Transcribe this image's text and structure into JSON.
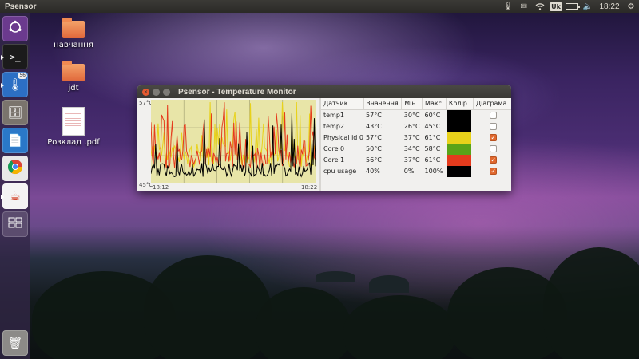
{
  "top_panel": {
    "app_title": "Psensor",
    "tray": {
      "psensor_icon": "thermometer-icon",
      "mail_icon": "envelope-icon",
      "network_icon": "wifi-icon",
      "keyboard_layout": "Uk",
      "battery_level": 0.85,
      "volume_icon": "speaker-icon",
      "time": "18:22",
      "settings_icon": "gear-icon"
    }
  },
  "launcher": {
    "items": [
      {
        "name": "dash-home",
        "icon": "ubuntu-logo-icon",
        "bg": "#6b3a8e"
      },
      {
        "name": "terminal",
        "icon": "terminal-icon",
        "bg": "#1b1b1b"
      },
      {
        "name": "psensor",
        "icon": "thermometer-icon",
        "bg": "#2c6fc4",
        "count": "56"
      },
      {
        "name": "files",
        "icon": "file-cabinet-icon",
        "bg": "#7a746d"
      },
      {
        "name": "libreoffice",
        "icon": "document-icon",
        "bg": "#2a78c8"
      },
      {
        "name": "chrome",
        "icon": "chrome-icon",
        "bg": "#e8e8e8"
      },
      {
        "name": "java",
        "icon": "java-cup-icon",
        "bg": "#f4f4f4"
      },
      {
        "name": "workspace-switcher",
        "icon": "workspaces-icon",
        "bg": "#5b4c6e"
      },
      {
        "name": "trash",
        "icon": "trash-icon",
        "bg": "#8c8a88"
      }
    ]
  },
  "desktop": {
    "icons": [
      {
        "label": "навчання",
        "type": "folder"
      },
      {
        "label": "jdt",
        "type": "folder"
      },
      {
        "label": "Розклад .pdf",
        "type": "pdf"
      }
    ]
  },
  "window": {
    "title": "Psensor - Temperature Monitor",
    "graph": {
      "y_top": "57°C",
      "y_bottom": "45°C",
      "x_start": "18:12",
      "x_end": "18:22",
      "background": "#e8e5a8"
    },
    "table": {
      "headers": [
        "Датчик",
        "Значення",
        "Мін.",
        "Макс.",
        "Колір",
        "Діаграма"
      ],
      "rows": [
        {
          "sensor": "temp1",
          "value": "57°C",
          "min": "30°C",
          "max": "60°C",
          "color": "#000000",
          "graph": false
        },
        {
          "sensor": "temp2",
          "value": "43°C",
          "min": "26°C",
          "max": "45°C",
          "color": "#000000",
          "graph": false
        },
        {
          "sensor": "Physical id 0",
          "value": "57°C",
          "min": "37°C",
          "max": "61°C",
          "color": "#e8d21a",
          "graph": true
        },
        {
          "sensor": "Core 0",
          "value": "50°C",
          "min": "34°C",
          "max": "58°C",
          "color": "#5aa318",
          "graph": false
        },
        {
          "sensor": "Core 1",
          "value": "56°C",
          "min": "37°C",
          "max": "61°C",
          "color": "#e53b1d",
          "graph": true
        },
        {
          "sensor": "cpu usage",
          "value": "40%",
          "min": "0%",
          "max": "100%",
          "color": "#000000",
          "graph": true
        }
      ]
    }
  }
}
